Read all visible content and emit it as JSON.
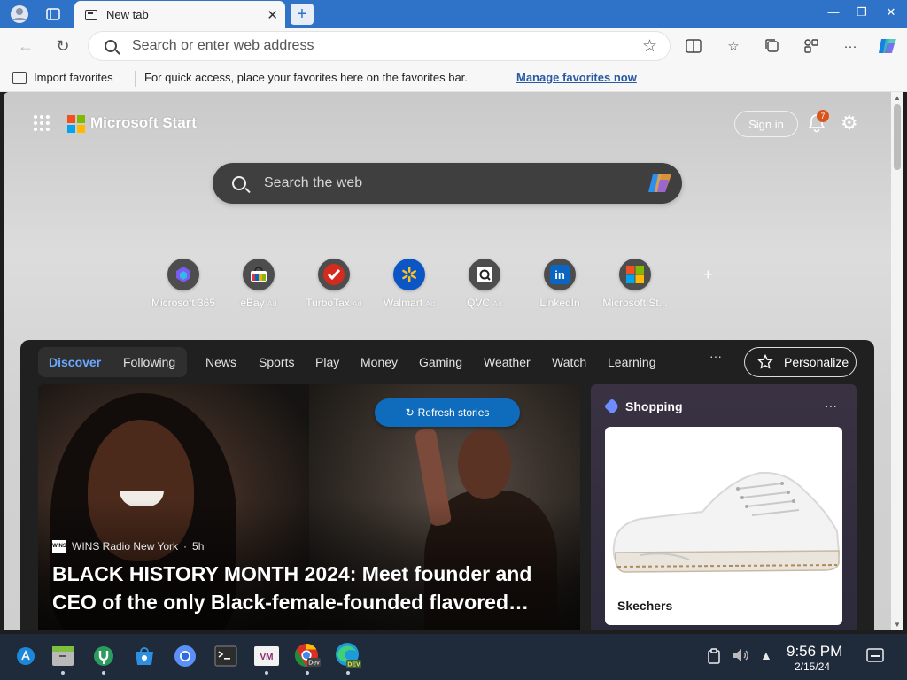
{
  "browser": {
    "tab_title": "New tab",
    "address_placeholder": "Search or enter web address",
    "favorites_bar": {
      "import_label": "Import favorites",
      "tip": "For quick access, place your favorites here on the favorites bar.",
      "manage_link": "Manage favorites now"
    }
  },
  "start": {
    "brand": "Microsoft Start",
    "sign_in": "Sign in",
    "notification_count": "7",
    "search_placeholder": "Search the web",
    "quick_links": [
      {
        "label": "Microsoft 365",
        "ad": ""
      },
      {
        "label": "eBay",
        "ad": "Ad"
      },
      {
        "label": "TurboTax",
        "ad": "Ad"
      },
      {
        "label": "Walmart",
        "ad": "Ad"
      },
      {
        "label": "QVC",
        "ad": "Ad"
      },
      {
        "label": "LinkedIn",
        "ad": ""
      },
      {
        "label": "Microsoft St...",
        "ad": ""
      }
    ]
  },
  "feed": {
    "tabs": [
      "Discover",
      "Following"
    ],
    "categories": [
      "News",
      "Sports",
      "Play",
      "Money",
      "Gaming",
      "Weather",
      "Watch",
      "Learning"
    ],
    "more": "···",
    "personalize": "Personalize",
    "refresh": "Refresh stories",
    "hero": {
      "source": "WINS Radio New York",
      "age": "5h",
      "headline": "BLACK HISTORY MONTH 2024: Meet founder and CEO of the only Black-female-founded flavored…"
    },
    "shopping": {
      "title": "Shopping",
      "product": "Skechers"
    }
  },
  "taskbar": {
    "time": "9:56 PM",
    "date": "2/15/24"
  },
  "colors": {
    "titlebar": "#2f73c9",
    "accent_link": "#2a5aa3",
    "refresh_button": "#0f6cbd",
    "taskbar": "#1f2a3a"
  }
}
